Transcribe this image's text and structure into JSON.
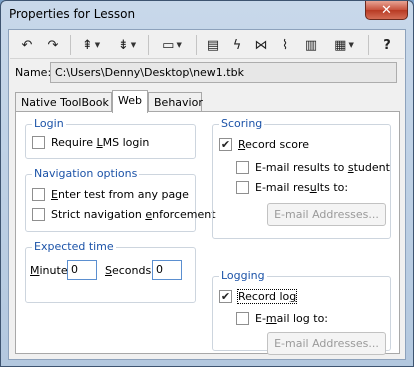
{
  "window": {
    "title": "Properties for Lesson",
    "close_glyph": "✕"
  },
  "toolbar": {
    "buttons": [
      {
        "icon": "undo-icon",
        "glyph": "↶"
      },
      {
        "icon": "redo-icon",
        "glyph": "↷"
      },
      {
        "icon": "align-icon",
        "glyph": "⇞"
      },
      {
        "icon": "distribute-icon",
        "glyph": "⇟"
      },
      {
        "icon": "ruler-icon",
        "glyph": "▭"
      },
      {
        "icon": "properties-icon",
        "glyph": "▤"
      },
      {
        "icon": "lightning-icon",
        "glyph": "ϟ"
      },
      {
        "icon": "connector-icon",
        "glyph": "⋈"
      },
      {
        "icon": "path-icon",
        "glyph": "⌇"
      },
      {
        "icon": "script-icon",
        "glyph": "▥"
      },
      {
        "icon": "list-icon",
        "glyph": "▦"
      },
      {
        "icon": "help-icon",
        "glyph": "?"
      }
    ]
  },
  "name": {
    "label": "Name:",
    "value": "C:\\Users\\Denny\\Desktop\\new1.tbk"
  },
  "tabs": [
    "Native ToolBook",
    "Web",
    "Behavior"
  ],
  "login": {
    "title": "Login",
    "require_lms": {
      "label_pre": "Require ",
      "label_u": "L",
      "label_post": "MS login",
      "checked": false
    }
  },
  "navigation": {
    "title": "Navigation options",
    "enter_any": {
      "label_pre": "",
      "label_u": "E",
      "label_post": "nter test from any page",
      "checked": false
    },
    "strict": {
      "label_pre": "Strict navigation ",
      "label_u": "e",
      "label_post": "nforcement",
      "checked": false
    }
  },
  "expected_time": {
    "title": "Expected time",
    "minutes_pre": "",
    "minutes_u": "M",
    "minutes_post": "inutes",
    "minutes_value": "0",
    "seconds_pre": "",
    "seconds_u": "S",
    "seconds_post": "econds",
    "seconds_value": "0"
  },
  "scoring": {
    "title": "Scoring",
    "record_score": {
      "label_pre": "",
      "label_u": "R",
      "label_post": "ecord score",
      "checked": true
    },
    "email_student": {
      "label_pre": "E-mail results to ",
      "label_u": "s",
      "label_post": "tudent",
      "checked": false
    },
    "email_results": {
      "label_pre": "E-mail res",
      "label_u": "u",
      "label_post": "lts to:",
      "checked": false
    },
    "addresses_button": "E-mail Addresses..."
  },
  "logging": {
    "title": "Logging",
    "record_log": {
      "label_pre": "Record lo",
      "label_u": "g",
      "label_post": "",
      "checked": true
    },
    "email_log": {
      "label_pre": "E-",
      "label_u": "m",
      "label_post": "ail log to:",
      "checked": false
    },
    "addresses_button": "E-mail Addresses..."
  },
  "check_glyph": "✔"
}
